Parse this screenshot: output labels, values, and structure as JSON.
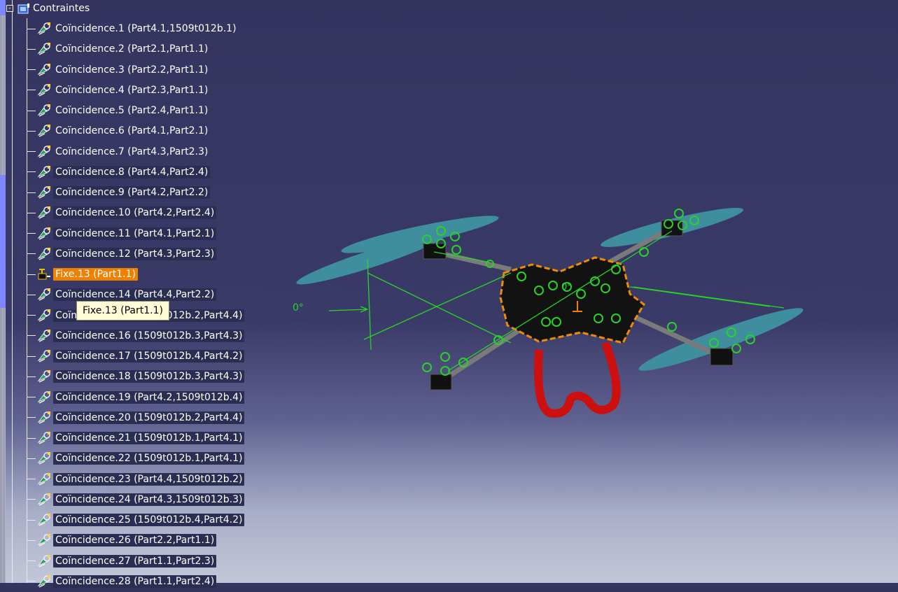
{
  "tree": {
    "root_label": "Contraintes",
    "root_expander": "-",
    "items": [
      {
        "label": "Coïncidence.1 (Part4.1,1509t012b.1)",
        "selected": false,
        "icon": "coincidence-constraint-icon"
      },
      {
        "label": "Coïncidence.2 (Part2.1,Part1.1)",
        "selected": false,
        "icon": "coincidence-constraint-icon"
      },
      {
        "label": "Coïncidence.3 (Part2.2,Part1.1)",
        "selected": false,
        "icon": "coincidence-constraint-icon"
      },
      {
        "label": "Coïncidence.4 (Part2.3,Part1.1)",
        "selected": false,
        "icon": "coincidence-constraint-icon"
      },
      {
        "label": "Coïncidence.5 (Part2.4,Part1.1)",
        "selected": false,
        "icon": "coincidence-constraint-icon"
      },
      {
        "label": "Coïncidence.6 (Part4.1,Part2.1)",
        "selected": false,
        "icon": "coincidence-constraint-icon"
      },
      {
        "label": "Coïncidence.7 (Part4.3,Part2.3)",
        "selected": false,
        "icon": "coincidence-constraint-icon"
      },
      {
        "label": "Coïncidence.8 (Part4.4,Part2.4)",
        "selected": true,
        "icon": "coincidence-constraint-icon"
      },
      {
        "label": "Coïncidence.9 (Part4.2,Part2.2)",
        "selected": true,
        "icon": "coincidence-constraint-icon"
      },
      {
        "label": "Coïncidence.10 (Part4.2,Part2.4)",
        "selected": true,
        "icon": "coincidence-constraint-icon"
      },
      {
        "label": "Coïncidence.11 (Part4.1,Part2.1)",
        "selected": true,
        "icon": "coincidence-constraint-icon"
      },
      {
        "label": "Coïncidence.12 (Part4.3,Part2.3)",
        "selected": true,
        "icon": "coincidence-constraint-icon"
      },
      {
        "label": "Fixe.13 (Part1.1)",
        "selected": false,
        "highlighted": true,
        "icon": "fix-constraint-icon"
      },
      {
        "label": "Coïncidence.14 (Part4.4,Part2.2)",
        "selected": true,
        "icon": "coincidence-constraint-icon"
      },
      {
        "label": "Coïncidence.15 (1509t012b.2,Part4.4)",
        "selected": true,
        "icon": "coincidence-constraint-icon"
      },
      {
        "label": "Coïncidence.16 (1509t012b.3,Part4.3)",
        "selected": true,
        "icon": "coincidence-constraint-icon"
      },
      {
        "label": "Coïncidence.17 (1509t012b.4,Part4.2)",
        "selected": true,
        "icon": "coincidence-constraint-icon"
      },
      {
        "label": "Coïncidence.18 (1509t012b.3,Part4.3)",
        "selected": true,
        "icon": "coincidence-constraint-icon"
      },
      {
        "label": "Coïncidence.19 (Part4.2,1509t012b.4)",
        "selected": true,
        "icon": "coincidence-constraint-icon"
      },
      {
        "label": "Coïncidence.20 (1509t012b.2,Part4.4)",
        "selected": true,
        "icon": "coincidence-constraint-icon"
      },
      {
        "label": "Coïncidence.21 (1509t012b.1,Part4.1)",
        "selected": true,
        "icon": "coincidence-constraint-icon"
      },
      {
        "label": "Coïncidence.22 (1509t012b.1,Part4.1)",
        "selected": true,
        "icon": "coincidence-constraint-icon"
      },
      {
        "label": "Coïncidence.23 (Part4.4,1509t012b.2)",
        "selected": true,
        "icon": "coincidence-constraint-icon"
      },
      {
        "label": "Coïncidence.24 (Part4.3,1509t012b.3)",
        "selected": true,
        "icon": "coincidence-constraint-icon"
      },
      {
        "label": "Coïncidence.25 (1509t012b.4,Part4.2)",
        "selected": true,
        "icon": "coincidence-constraint-icon"
      },
      {
        "label": "Coïncidence.26 (Part2.2,Part1.1)",
        "selected": true,
        "icon": "coincidence-constraint-icon"
      },
      {
        "label": "Coïncidence.27 (Part1.1,Part2.3)",
        "selected": true,
        "icon": "coincidence-constraint-icon"
      },
      {
        "label": "Coïncidence.28 (Part1.1,Part2.4)",
        "selected": true,
        "icon": "coincidence-constraint-icon"
      }
    ]
  },
  "tooltip": {
    "text": "Fixe.13 (Part1.1)"
  },
  "viewport": {
    "angle_label": "0°",
    "center_angle_label": "0°",
    "colors": {
      "constraint_green": "#2ad12a",
      "propeller": "#3f8e9e",
      "frame": "#111111",
      "frame_edge": "#f08c00",
      "landing_gear": "#cc1010",
      "highlight": "#f08000"
    }
  }
}
